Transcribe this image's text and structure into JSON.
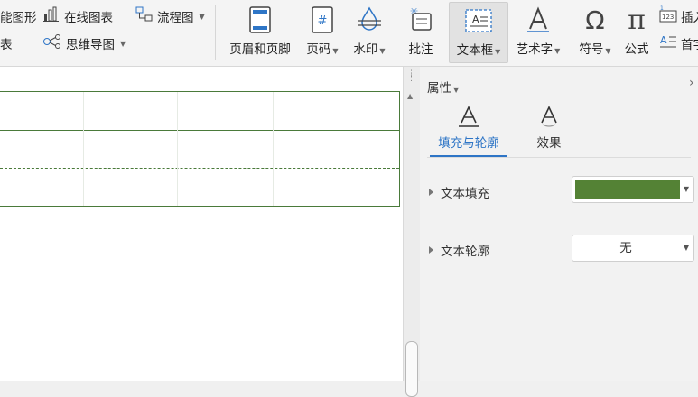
{
  "ribbon": {
    "smart_graphic": "能图形",
    "table_label": "表",
    "online_chart": "在线图表",
    "flowchart": "流程图",
    "mindmap": "思维导图",
    "header_footer": "页眉和页脚",
    "page_number": "页码",
    "watermark": "水印",
    "comment": "批注",
    "textbox": "文本框",
    "wordart": "艺术字",
    "symbol": "符号",
    "formula": "公式",
    "insert_num": "插入",
    "dropcap": "首字"
  },
  "pane": {
    "title": "属性",
    "tabs": [
      {
        "label": "填充与轮廓"
      },
      {
        "label": "效果"
      }
    ],
    "text_fill_label": "文本填充",
    "text_fill_color": "#548235",
    "text_outline_label": "文本轮廓",
    "text_outline_value": "无"
  },
  "colors": {
    "accent": "#2e75c6",
    "table_border": "#4a7a3a"
  }
}
